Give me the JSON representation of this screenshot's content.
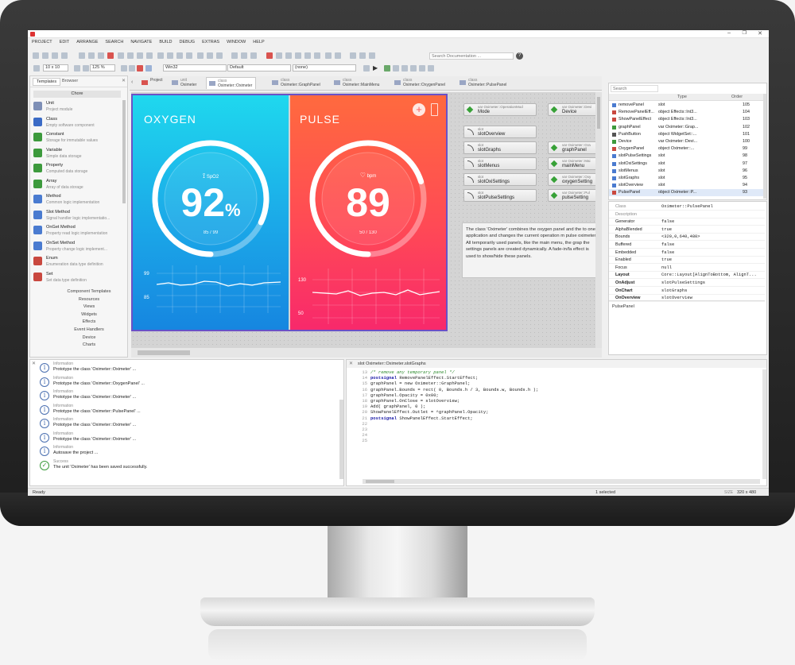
{
  "app": {
    "status_left": "Ready",
    "status_mid": "1 selected",
    "status_size_label": "SIZE",
    "status_size": "320 x 480"
  },
  "menu": [
    "PROJECT",
    "EDIT",
    "ARRANGE",
    "SEARCH",
    "NAVIGATE",
    "BUILD",
    "DEBUG",
    "EXTRAS",
    "WINDOW",
    "HELP"
  ],
  "toolbar": {
    "search_placeholder": "Search Documentation ...",
    "grid": "10 x 10",
    "zoom": "125 %",
    "platform": "Win32",
    "profile": "Default",
    "style": "(none)"
  },
  "left_tabs": {
    "templates": "Templates",
    "browser": "Browser",
    "section": "Chore"
  },
  "bricks": [
    {
      "title": "Unit",
      "sub": "Project module",
      "color": "#7e8fb6"
    },
    {
      "title": "Class",
      "sub": "Empty software component",
      "color": "#3b6bc6"
    },
    {
      "title": "Constant",
      "sub": "Storage for immutable values",
      "color": "#3d9a3d"
    },
    {
      "title": "Variable",
      "sub": "Simple data storage",
      "color": "#3d9a3d"
    },
    {
      "title": "Property",
      "sub": "Computed data storage",
      "color": "#3d9a3d"
    },
    {
      "title": "Array",
      "sub": "Array of  data storage",
      "color": "#3d9a3d"
    },
    {
      "title": "Method",
      "sub": "Common logic implementation",
      "color": "#4a7bd0"
    },
    {
      "title": "Slot Method",
      "sub": "Signal handler logic implementatio...",
      "color": "#4a7bd0"
    },
    {
      "title": "OnGet Method",
      "sub": "Property read logic implementation",
      "color": "#4a7bd0"
    },
    {
      "title": "OnSet Method",
      "sub": "Property change logic implement...",
      "color": "#4a7bd0"
    },
    {
      "title": "Enum",
      "sub": "Enumeration data type definition",
      "color": "#c9483f"
    },
    {
      "title": "Set",
      "sub": "Set data type definition",
      "color": "#c9483f"
    }
  ],
  "tree": [
    "Component Templates",
    "Resources",
    "Views",
    "Widgets",
    "Effects",
    "Event Handlers",
    "Device",
    "Charts"
  ],
  "tabs": [
    {
      "k": "",
      "n": "Project"
    },
    {
      "k": "unit",
      "n": "Oximeter"
    },
    {
      "k": "class",
      "n": "Oximeter::Oximeter"
    },
    {
      "k": "class",
      "n": "Oximeter::GraphPanel"
    },
    {
      "k": "class",
      "n": "Oximeter::MainMenu"
    },
    {
      "k": "class",
      "n": "Oximeter::OxygenPanel"
    },
    {
      "k": "class",
      "n": "Oximeter::PulsePanel"
    }
  ],
  "oxygen": {
    "title": "OXYGEN",
    "label": "SpO2",
    "value": "92",
    "unit": "%",
    "range": "85 / 99",
    "gauge_fraction": 0.82,
    "y_hi": "99",
    "y_lo": "85"
  },
  "pulse": {
    "title": "PULSE",
    "label": "bpm",
    "value": "89",
    "range": "50 / 130",
    "gauge_fraction": 0.7,
    "y_hi": "130",
    "y_lo": "50"
  },
  "nodes_left": [
    {
      "k": "var Oximeter::OperationMod",
      "n": "Mode",
      "t": "var"
    },
    {
      "k": "slot",
      "n": "slotOverview",
      "t": "slot"
    },
    {
      "k": "slot",
      "n": "slotGraphs",
      "t": "slot"
    },
    {
      "k": "slot",
      "n": "slotMenus",
      "t": "slot"
    },
    {
      "k": "slot",
      "n": "slotOxiSettings",
      "t": "slot"
    },
    {
      "k": "slot",
      "n": "slotPulseSettings",
      "t": "slot"
    }
  ],
  "nodes_right": [
    {
      "k": "var Oximeter::Devi",
      "n": "Device"
    },
    {
      "k": "var Oximeter::Gra",
      "n": "graphPanel"
    },
    {
      "k": "var Oximeter::Mai",
      "n": "mainMenu"
    },
    {
      "k": "var Oximeter::Oxy",
      "n": "oxygenSetting"
    },
    {
      "k": "var Oximeter::Pul",
      "n": "pulseSetting"
    }
  ],
  "description": "The class 'Oximeter' combines the oxygen panel and the to one application and changes the current operation m pulse oximeter.\nAll temporarily used panels, like the main menu, the grap the settings panels are created dynamically. A fade-in/fa effect is used to show/hide these panels.",
  "members_header": {
    "search": "Search",
    "c1": "",
    "c2": "Type",
    "c3": "Order"
  },
  "members": [
    {
      "n": "removePanel",
      "t": "slot",
      "o": "105"
    },
    {
      "n": "RemovePanelEff...",
      "t": "object Effects::Int3...",
      "o": "104"
    },
    {
      "n": "ShowPanelEffect",
      "t": "object Effects::Int3...",
      "o": "103"
    },
    {
      "n": "graphPanel",
      "t": "var Oximeter::Grap...",
      "o": "102"
    },
    {
      "n": "PushButton",
      "t": "object WidgetSet::...",
      "o": "101"
    },
    {
      "n": "Device",
      "t": "var Oximeter::Devi...",
      "o": "100"
    },
    {
      "n": "OxygenPanel",
      "t": "object Oximeter::...",
      "o": "99"
    },
    {
      "n": "slotPulseSettings",
      "t": "slot",
      "o": "98"
    },
    {
      "n": "slotOxiSettings",
      "t": "slot",
      "o": "97"
    },
    {
      "n": "slotMenus",
      "t": "slot",
      "o": "96"
    },
    {
      "n": "slotGraphs",
      "t": "slot",
      "o": "95"
    },
    {
      "n": "slotOverview",
      "t": "slot",
      "o": "94"
    },
    {
      "n": "PulsePanel",
      "t": "object Oximeter::P...",
      "o": "93"
    }
  ],
  "inspector": [
    {
      "k": "Class",
      "v": "Oximeter::PulsePanel"
    },
    {
      "k": "Description",
      "v": ""
    },
    {
      "k": "Generator",
      "v": "false"
    },
    {
      "k": "AlphaBlended",
      "v": "true"
    },
    {
      "k": "Bounds",
      "v": "<320,0,640,480>"
    },
    {
      "k": "Buffered",
      "v": "false"
    },
    {
      "k": "Embedded",
      "v": "false"
    },
    {
      "k": "Enabled",
      "v": "true"
    },
    {
      "k": "Focus",
      "v": "null"
    },
    {
      "k": "Layout",
      "v": "Core::Layout[AlignToBottom, AlignT..."
    },
    {
      "k": "OnAdjust",
      "v": "slotPulseSettings"
    },
    {
      "k": "OnChart",
      "v": "slotGraphs"
    },
    {
      "k": "OnOverview",
      "v": "slotOverview"
    }
  ],
  "inspector_footer": "PulsePanel",
  "log": [
    {
      "k": "Information",
      "m": "Prototype the class 'Oximeter::Oximeter' ...",
      "ok": false
    },
    {
      "k": "Information",
      "m": "Prototype the class 'Oximeter::OxygenPanel' ...",
      "ok": false
    },
    {
      "k": "Information",
      "m": "Prototype the class 'Oximeter::Oximeter' ...",
      "ok": false
    },
    {
      "k": "Information",
      "m": "Prototype the class 'Oximeter::PulsePanel' ...",
      "ok": false
    },
    {
      "k": "Information",
      "m": "Prototype the class 'Oximeter::Oximeter' ...",
      "ok": false
    },
    {
      "k": "Information",
      "m": "Prototype the class 'Oximeter::Oximeter' ...",
      "ok": false
    },
    {
      "k": "Information",
      "m": "Autosave the project ...",
      "ok": false
    },
    {
      "k": "Success",
      "m": "The unit 'Oximeter' has been saved successfully.",
      "ok": true
    }
  ],
  "code": {
    "title": "slot Oximeter::Oximeter.slotGraphs",
    "lines": [
      {
        "n": "13",
        "t": ""
      },
      {
        "n": "14",
        "t": "/* remove any temporary panel */",
        "c": "cm"
      },
      {
        "n": "15",
        "t": "postsignal RemovePanelEffect.StartEffect;",
        "kw": "postsignal"
      },
      {
        "n": "16",
        "t": ""
      },
      {
        "n": "17",
        "t": "graphPanel = new Oximeter::GraphPanel;"
      },
      {
        "n": "18",
        "t": "graphPanel.Bounds = rect( 0, Bounds.h / 3, Bounds.w, Bounds.h );"
      },
      {
        "n": "19",
        "t": "graphPanel.Opacity = 0x00;"
      },
      {
        "n": "20",
        "t": "graphPanel.OnClose = slotOverview;"
      },
      {
        "n": "21",
        "t": "Add( graphPanel, 0 );"
      },
      {
        "n": "22",
        "t": "ShowPanelEffect.Outlet = ^graphPanel.Opacity;"
      },
      {
        "n": "23",
        "t": "postsignal ShowPanelEffect.StartEffect;",
        "kw": "postsignal"
      },
      {
        "n": "24",
        "t": ""
      },
      {
        "n": "25",
        "t": ""
      }
    ]
  }
}
